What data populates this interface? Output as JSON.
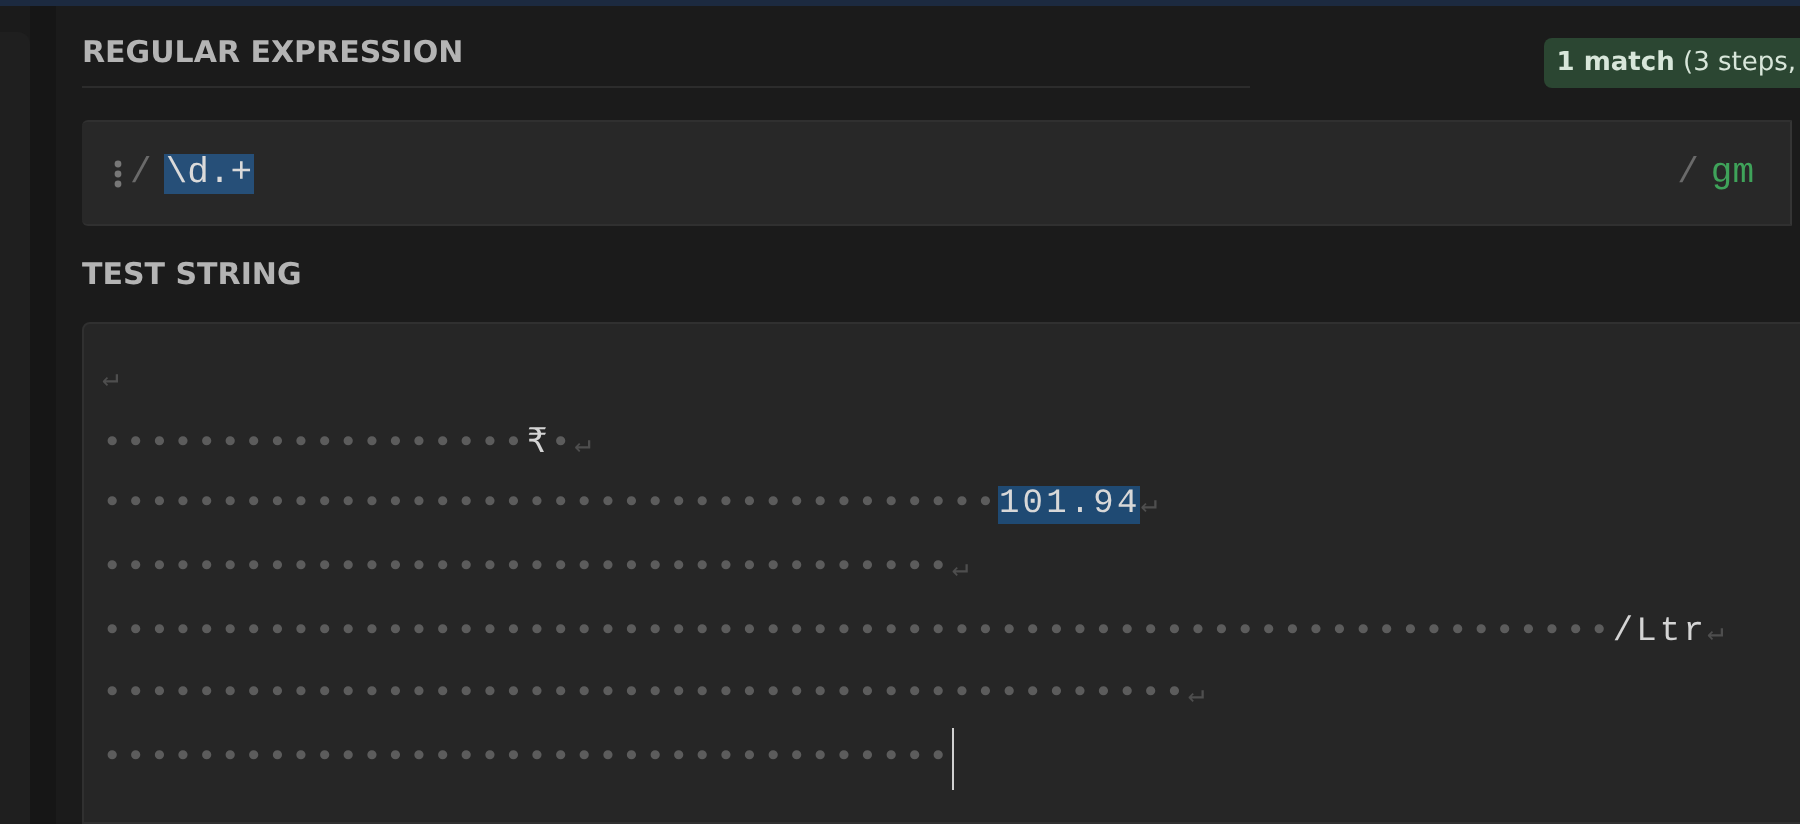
{
  "regex_section": {
    "heading": "REGULAR EXPRESSION",
    "match_info": "**1 match** (3 steps,",
    "open_delimiter": "/",
    "pattern": "\\d.+",
    "pattern_selected": true,
    "close_delimiter": "/",
    "flags": "gm"
  },
  "test_section": {
    "heading": "TEST STRING",
    "lines": [
      {
        "segments": [
          {
            "kind": "newline",
            "text": "↵"
          }
        ],
        "cursor": false
      },
      {
        "segments": [
          {
            "kind": "whitespace",
            "text": "••••••••••••••••••"
          },
          {
            "kind": "text",
            "text": "₹"
          },
          {
            "kind": "whitespace",
            "text": "•"
          },
          {
            "kind": "newline",
            "text": "↵"
          }
        ],
        "cursor": false
      },
      {
        "segments": [
          {
            "kind": "whitespace",
            "text": "••••••••••••••••••••••••••••••••••••••"
          },
          {
            "kind": "match",
            "text": "101.94"
          },
          {
            "kind": "newline",
            "text": "↵"
          }
        ],
        "cursor": false
      },
      {
        "segments": [
          {
            "kind": "whitespace",
            "text": "••••••••••••••••••••••••••••••••••••"
          },
          {
            "kind": "newline",
            "text": "↵"
          }
        ],
        "cursor": false
      },
      {
        "segments": [
          {
            "kind": "whitespace",
            "text": "••••••••••••••••••••••••••••••••••••••••••••••••••••••••••••••••"
          },
          {
            "kind": "text",
            "text": "/Ltr"
          },
          {
            "kind": "newline",
            "text": "↵"
          }
        ],
        "cursor": false
      },
      {
        "segments": [
          {
            "kind": "whitespace",
            "text": "••••••••••••••••••••••••••••••••••••••••••••••"
          },
          {
            "kind": "newline",
            "text": "↵"
          }
        ],
        "cursor": false
      },
      {
        "segments": [
          {
            "kind": "whitespace",
            "text": "••••••••••••••••••••••••••••••••••••"
          }
        ],
        "cursor": true
      }
    ]
  }
}
